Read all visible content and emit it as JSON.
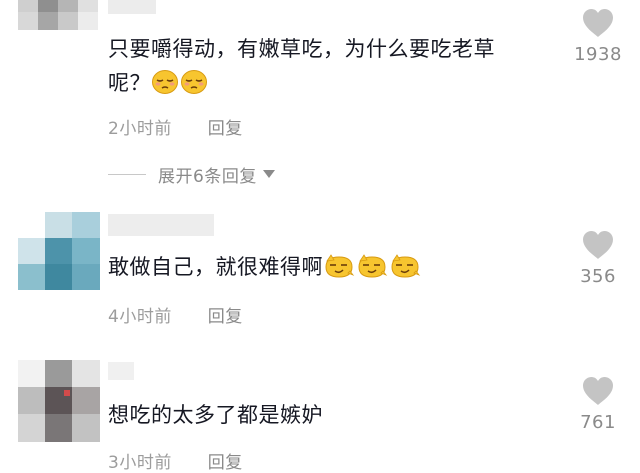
{
  "comments": [
    {
      "text_line1": "只要嚼得动，有嫩草吃，为什么要吃老草",
      "text_line2": "呢？",
      "emojis": [
        "pensive-face-emoji",
        "pensive-face-emoji"
      ],
      "time": "2小时前",
      "reply_label": "回复",
      "likes": "1938"
    },
    {
      "text": "敢做自己，就很难得啊",
      "emojis": [
        "smug-face-emoji",
        "smug-face-emoji",
        "smug-face-emoji"
      ],
      "time": "4小时前",
      "reply_label": "回复",
      "likes": "356"
    },
    {
      "text": "想吃的太多了都是嫉妒",
      "time": "3小时前",
      "reply_label": "回复",
      "likes": "761"
    }
  ],
  "expand_replies": {
    "label": "展开6条回复"
  },
  "colors": {
    "text": "#161823",
    "meta": "#9c9c9c",
    "like_icon": "#c4c4c4",
    "emoji_fill": "#f7c52f"
  }
}
